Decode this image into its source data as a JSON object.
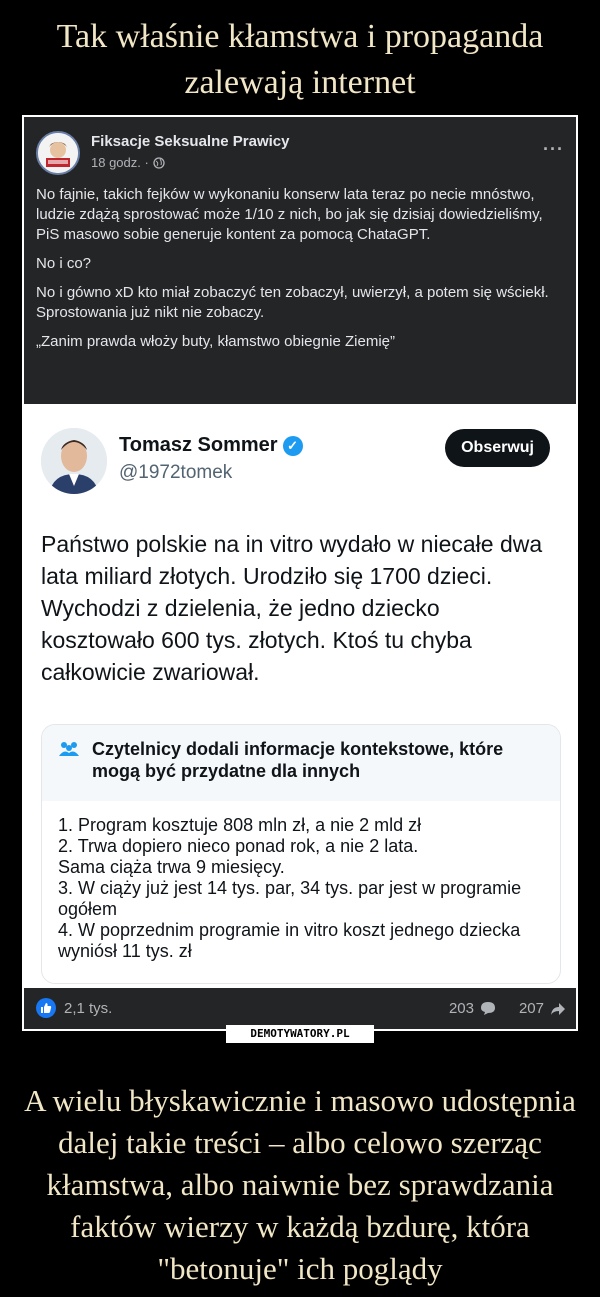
{
  "meme": {
    "title": "Tak właśnie kłamstwa i propaganda zalewają internet",
    "caption": "A wielu błyskawicznie i masowo udostępnia dalej takie treści – albo celowo szerząc kłamstwa, albo naiwnie bez sprawdzania faktów wierzy w każdą bzdurę, która \"betonuje\" ich poglądy",
    "watermark": "DEMOTYWATORY.PL"
  },
  "fb_post": {
    "author": "Fiksacje Seksualne Prawicy",
    "time": "18 godz. ·",
    "more": "···",
    "paragraphs": [
      "No fajnie, takich fejków w wykonaniu konserw lata teraz po necie mnóstwo, ludzie zdążą sprostować może 1/10 z nich, bo jak się dzisiaj dowiedzieliśmy, PiS masowo sobie generuje kontent za pomocą ChataGPT.",
      "No i co?",
      "No i gówno xD kto miał zobaczyć ten zobaczył, uwierzył, a potem się wściekł. Sprostowania już nikt nie zobaczy.",
      "„Zanim prawda włoży buty, kłamstwo obiegnie Ziemię”"
    ],
    "likes": "2,1 tys.",
    "comments": "203",
    "shares": "207"
  },
  "tweet": {
    "name": "Tomasz Sommer",
    "handle": "@1972tomek",
    "follow_label": "Obserwuj",
    "text": "Państwo polskie na in vitro wydało w niecałe dwa lata miliard złotych. Urodziło się 1700 dzieci. Wychodzi z dzielenia, że jedno dziecko kosztowało 600 tys. złotych. Ktoś tu chyba całkowicie zwariował.",
    "note_title": "Czytelnicy dodali informacje kontekstowe, które mogą być przydatne dla innych",
    "note_lines": [
      "1. Program kosztuje 808 mln zł, a nie 2 mld zł",
      "2. Trwa dopiero nieco ponad rok, a nie 2 lata.\nSama ciąża trwa 9 miesięcy.",
      "3. W ciąży już jest 14 tys. par, 34 tys. par jest w programie ogółem",
      "4. W poprzednim programie in vitro koszt jednego dziecka wyniósł 11 tys. zł"
    ]
  },
  "colors": {
    "caption_text": "#f1e6c5",
    "fb_bg": "#242526",
    "like_blue": "#1877f2",
    "twitter_blue": "#1d9bf0"
  }
}
